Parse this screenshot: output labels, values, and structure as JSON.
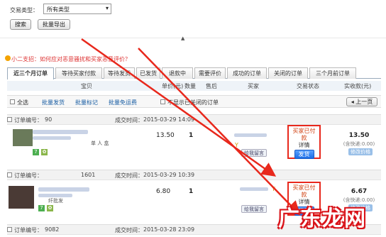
{
  "filters": {
    "trade_type_label": "交易类型：",
    "trade_type_value": "所有类型"
  },
  "buttons": {
    "search": "搜索",
    "batch_export": "批量导出"
  },
  "notice": "小二支招：如何应对恶意骚扰和买家恶意评价？",
  "tabs": [
    "近三个月订单",
    "等待买家付款",
    "等待发货",
    "已发货",
    "退款中",
    "需要评价",
    "成功的订单",
    "关闭的订单",
    "三个月前订单"
  ],
  "columns": {
    "item": "宝贝",
    "unit_price": "单价(元)",
    "quantity": "数量",
    "after_sale": "售后",
    "buyer": "买家",
    "trade_status": "交易状态",
    "amount_received": "实收款(元)"
  },
  "actions": {
    "select_all": "全选",
    "batch_ship": "批量发货",
    "batch_mark": "批量标记",
    "batch_free_ship": "批量免运费",
    "hide_closed": "不显示已关闭的订单",
    "prev_page": "上一页"
  },
  "orders": [
    {
      "order_no_label": "订单编号：",
      "order_no": "90",
      "time_label": "成交时间：",
      "time": "2015-03-29 14:09",
      "price": "13.50",
      "qty": "1",
      "item_tail": "单 人 盒",
      "status": "买家已付款",
      "detail": "详情",
      "ship": "发货",
      "msg": "给我留言",
      "paid": "13.50",
      "paid_sub": "(含快递:0.00)",
      "tag": "修改价格"
    },
    {
      "order_no_label": "订单编号：",
      "order_no": "1601",
      "time_label": "成交时间：",
      "time": "2015-03-29 10:39",
      "price": "6.80",
      "qty": "1",
      "item_tail": "纤批发",
      "status": "买家已付款",
      "detail": "详情",
      "ship": "发货",
      "msg": "给我留言",
      "paid": "6.67",
      "paid_sub": "(含快递:0.00)",
      "tag": "修改价格"
    },
    {
      "order_no_label": "订单编号：",
      "order_no": "9082",
      "time_label": "成交时间：",
      "time": "2015-03-28 23:09"
    }
  ],
  "watermark": "广东龙网",
  "colors": {
    "accent": "#1d6ee6",
    "alert": "#e8281c",
    "status": "#d04010"
  }
}
